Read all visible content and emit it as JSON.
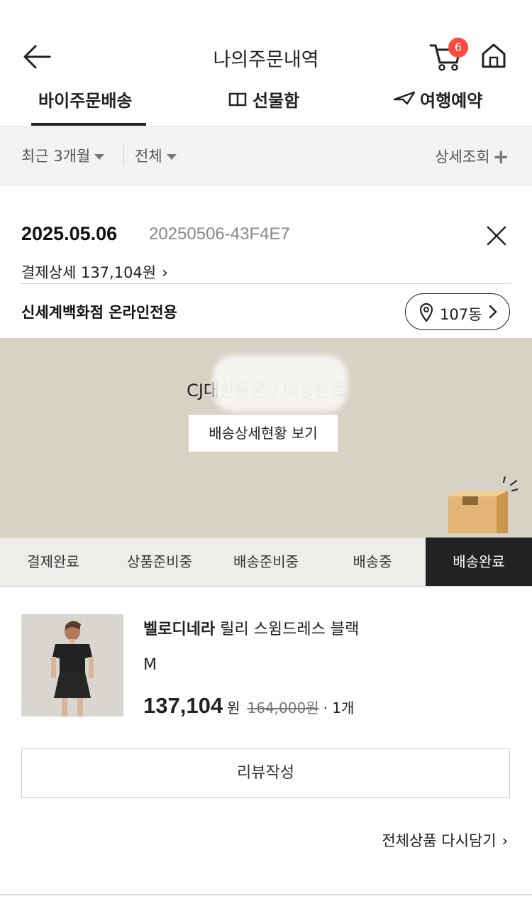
{
  "header": {
    "title": "나의주문내역",
    "cart_count": "6"
  },
  "tabs": [
    {
      "label": "바이주문배송"
    },
    {
      "label": "선물함"
    },
    {
      "label": "여행예약"
    }
  ],
  "filters": {
    "period": "최근 3개월",
    "status": "전체",
    "detail_search": "상세조회"
  },
  "order": {
    "date": "2025.05.06",
    "order_number": "20250506-43F4E7",
    "payment_detail": "결제상세 137,104원",
    "store": "신세계백화점 온라인전용",
    "dong": "107동"
  },
  "delivery": {
    "status_text": "CJ대한통운 / 배송완료",
    "tracking_button": "배송상세현황 보기"
  },
  "steps": [
    "결제완료",
    "상품준비중",
    "배송준비중",
    "배송중",
    "배송완료"
  ],
  "active_step": "배송완료",
  "product": {
    "brand": "벨로디네라",
    "name": "릴리 스윔드레스 블랙",
    "option": "M",
    "price": "137,104",
    "price_unit": "원",
    "original_price": "164,000원",
    "quantity": "· 1개"
  },
  "actions": {
    "review": "리뷰작성",
    "reorder_all": "전체상품 다시담기"
  },
  "colors": {
    "badge": "#ff4a3d",
    "banner_bg": "#d6d2c5",
    "active_step_bg": "#222222",
    "filter_bg": "#f3f3f3"
  }
}
